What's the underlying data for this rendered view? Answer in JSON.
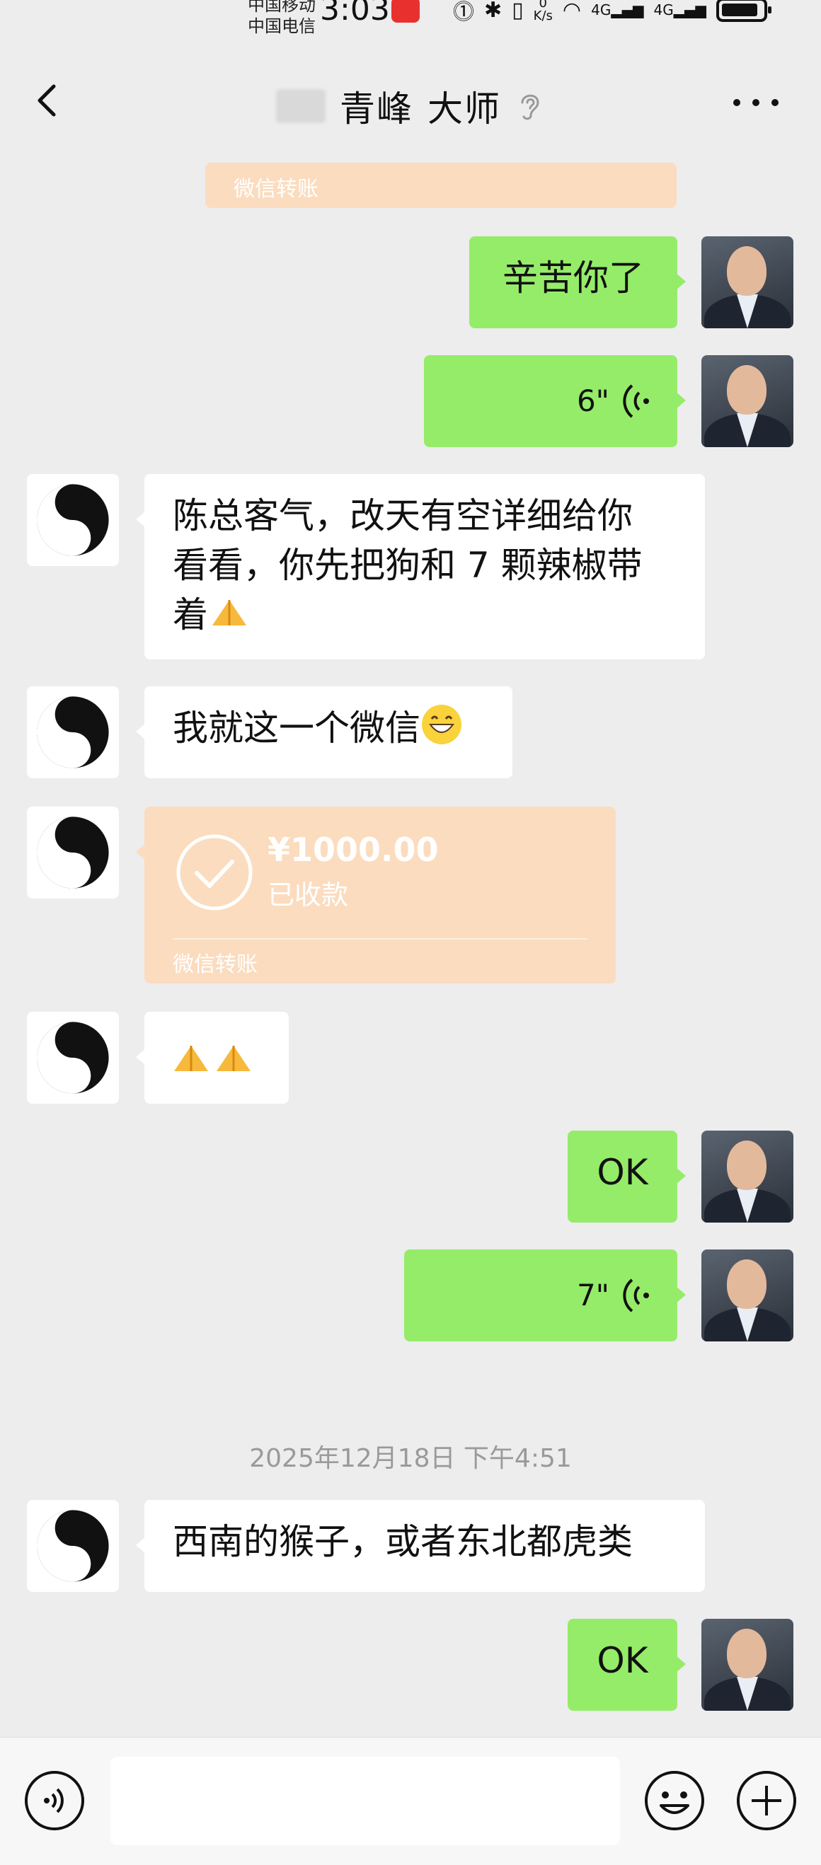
{
  "status_bar": {
    "carrier_line1": "中国移动",
    "carrier_line2": "中国电信",
    "time": "3:03",
    "net_speed_value": "0",
    "net_speed_unit": "K/s",
    "signal_1": "4G",
    "signal_2": "4G"
  },
  "header": {
    "title_part1": "青峰",
    "title_part2": "大师",
    "back_label": "back",
    "more_label": "more"
  },
  "messages": [
    {
      "id": "m0",
      "type": "transfer-partial",
      "sender": "other",
      "footer": "微信转账"
    },
    {
      "id": "m1",
      "type": "text",
      "sender": "me",
      "text": "辛苦你了"
    },
    {
      "id": "m2",
      "type": "voice",
      "sender": "me",
      "duration": "6\""
    },
    {
      "id": "m3",
      "type": "text",
      "sender": "other",
      "line1": "陈总客气，改天有空详细给你",
      "line2": "看看，你先把狗和 7 颗辣椒带",
      "line3": "着"
    },
    {
      "id": "m4",
      "type": "text",
      "sender": "other",
      "text": "我就这一个微信"
    },
    {
      "id": "m5",
      "type": "transfer",
      "sender": "other",
      "amount": "¥1000.00",
      "status": "已收款",
      "footer": "微信转账"
    },
    {
      "id": "m6",
      "type": "emoji",
      "sender": "other",
      "emoji": "🙏🙏"
    },
    {
      "id": "m7",
      "type": "text",
      "sender": "me",
      "text": "OK"
    },
    {
      "id": "m8",
      "type": "voice",
      "sender": "me",
      "duration": "7\""
    },
    {
      "id": "m9",
      "type": "timestamp",
      "text": "2025年12月18日 下午4:51"
    },
    {
      "id": "m10",
      "type": "text",
      "sender": "other",
      "text": "西南的猴子，或者东北都虎类"
    },
    {
      "id": "m11",
      "type": "text",
      "sender": "me",
      "text": "OK"
    }
  ],
  "input_bar": {
    "placeholder": "",
    "voice_button": "voice-input",
    "emoji_button": "emoji",
    "plus_button": "more-actions"
  },
  "colors": {
    "bubble_mine": "#95ec69",
    "bubble_theirs": "#ffffff",
    "transfer": "#fbdcbf",
    "background": "#ededed"
  }
}
